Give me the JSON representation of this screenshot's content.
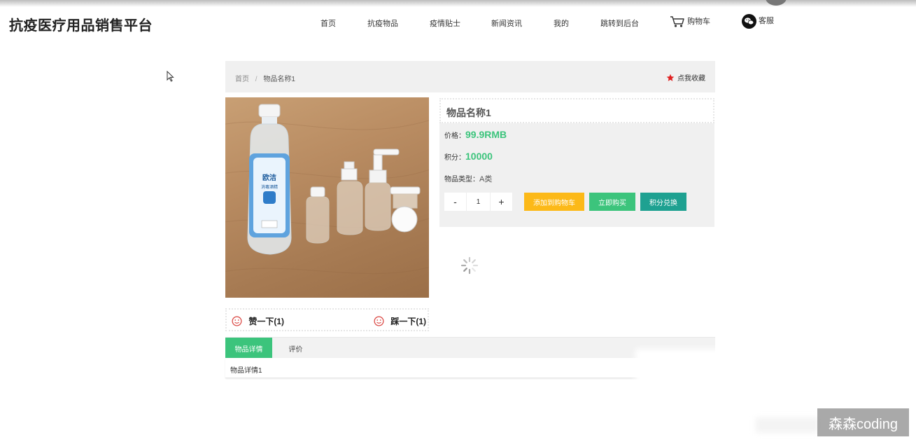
{
  "header": {
    "logo": "抗疫医疗用品销售平台",
    "nav": [
      {
        "label": "首页",
        "icon": ""
      },
      {
        "label": "抗疫物品",
        "icon": ""
      },
      {
        "label": "疫情贴士",
        "icon": ""
      },
      {
        "label": "新闻资讯",
        "icon": ""
      },
      {
        "label": "我的",
        "icon": ""
      },
      {
        "label": "跳转到后台",
        "icon": ""
      }
    ],
    "cart": {
      "label": "购物车",
      "icon": "shopping-cart-icon"
    },
    "service": {
      "label": "客服",
      "icon": "wechat-icon"
    }
  },
  "breadcrumb": {
    "home": "首页",
    "separator": "/",
    "current": "物品名称1"
  },
  "favorite": {
    "label": "点我收藏",
    "icon": "star-icon",
    "color": "#e02020"
  },
  "product": {
    "name": "物品名称1",
    "price_label": "价格：",
    "price_value": "99.9RMB",
    "points_label": "积分：",
    "points_value": "10000",
    "type_label": "物品类型：",
    "type_value": "A类",
    "image_alt": "product-photo"
  },
  "quantity": {
    "minus": "-",
    "value": "1",
    "plus": "+"
  },
  "actions": {
    "add_to_cart": {
      "label": "添加到购物车",
      "color": "#fcb918"
    },
    "buy_now": {
      "label": "立即购买",
      "color": "#3cc47c"
    },
    "redeem": {
      "label": "积分兑换",
      "color": "#1ea191"
    }
  },
  "votes": {
    "like": {
      "label": "赞一下(1)",
      "icon": "smile-icon"
    },
    "dislike": {
      "label": "踩一下(1)",
      "icon": "smile-icon"
    },
    "icon_color": "#d9413d"
  },
  "tabs": [
    {
      "label": "物品详情",
      "active": true
    },
    {
      "label": "评价",
      "active": false
    }
  ],
  "tab_content": "物品详情1",
  "watermark": "森森coding",
  "colors": {
    "accent_green": "#3cc47c",
    "panel_gray": "#f0f0f0"
  }
}
